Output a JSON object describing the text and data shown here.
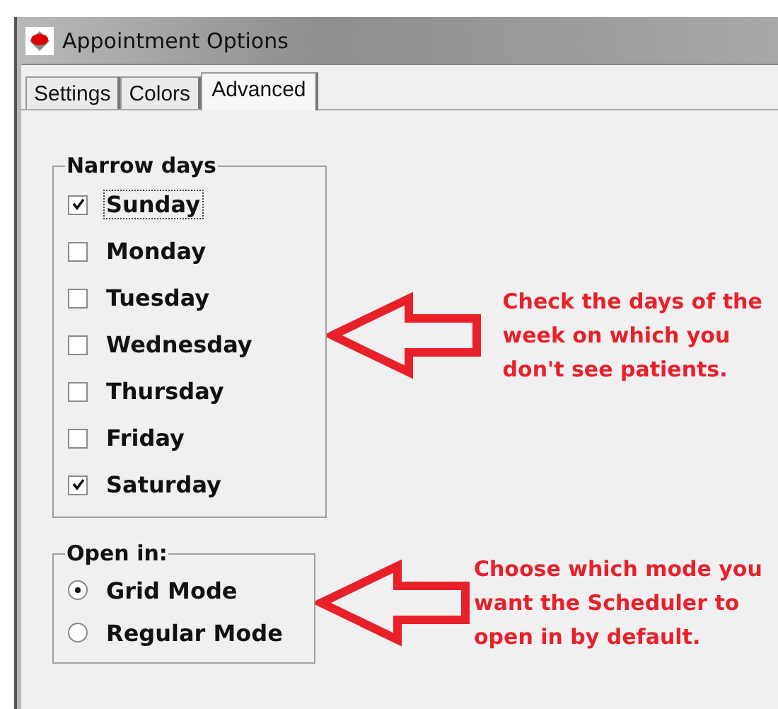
{
  "window": {
    "title": "Appointment Options"
  },
  "tabs": [
    {
      "label": "Settings",
      "selected": false
    },
    {
      "label": "Colors",
      "selected": false
    },
    {
      "label": "Advanced",
      "selected": true
    }
  ],
  "narrow_days": {
    "title": "Narrow days",
    "items": [
      {
        "label": "Sunday",
        "checked": true,
        "focused": true
      },
      {
        "label": "Monday",
        "checked": false
      },
      {
        "label": "Tuesday",
        "checked": false
      },
      {
        "label": "Wednesday",
        "checked": false
      },
      {
        "label": "Thursday",
        "checked": false
      },
      {
        "label": "Friday",
        "checked": false
      },
      {
        "label": "Saturday",
        "checked": true
      }
    ],
    "note": "Check the days of the week on which you don't see patients."
  },
  "open_in": {
    "title": "Open in:",
    "options": [
      {
        "label": "Grid Mode",
        "selected": true
      },
      {
        "label": "Regular Mode",
        "selected": false
      }
    ],
    "note": "Choose which mode you want the Scheduler to open in by default."
  }
}
